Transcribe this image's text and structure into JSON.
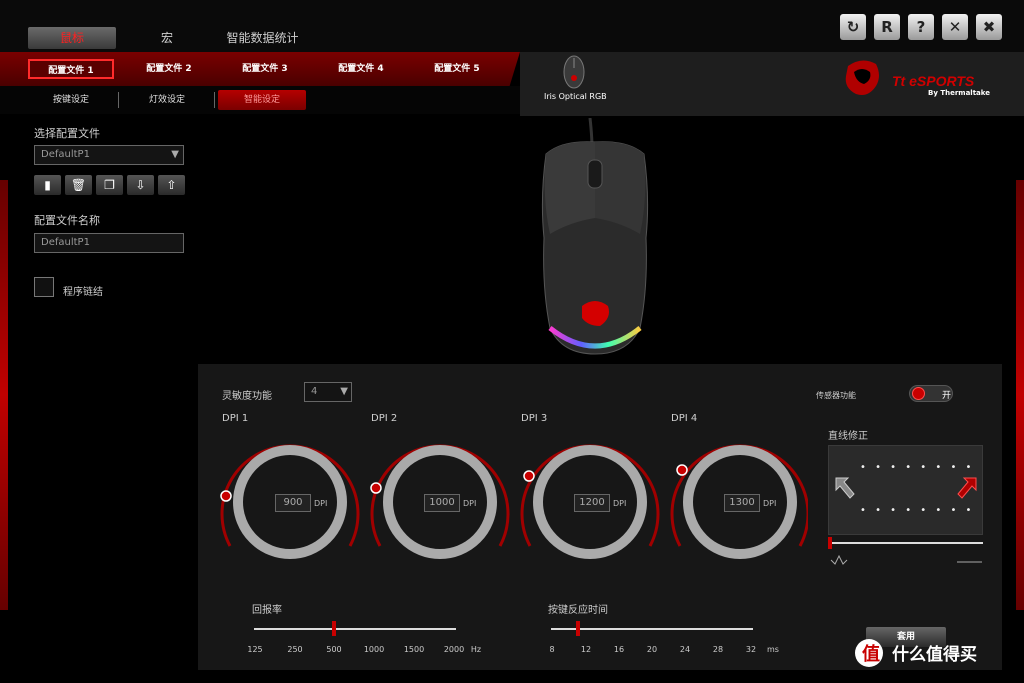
{
  "main_tabs": [
    "鼠标",
    "宏",
    "智能数据统计"
  ],
  "profile_tabs": [
    "配置文件 1",
    "配置文件 2",
    "配置文件 3",
    "配置文件 4",
    "配置文件 5"
  ],
  "sub_tabs": [
    "按键设定",
    "灯效设定",
    "智能设定"
  ],
  "device_name": "Iris Optical RGB",
  "brand": {
    "name": "Tt eSPORTS",
    "sub": "By Thermaltake"
  },
  "top_buttons": [
    {
      "icon": "refresh-icon",
      "glyph": "↻"
    },
    {
      "icon": "reset-icon",
      "glyph": "R"
    },
    {
      "icon": "help-icon",
      "glyph": "?"
    },
    {
      "icon": "close-icon",
      "glyph": "✕"
    },
    {
      "icon": "tools-icon",
      "glyph": "✖"
    }
  ],
  "left_panel": {
    "select_profile_label": "选择配置文件",
    "selected_profile": "DefaultP1",
    "profile_name_label": "配置文件名称",
    "profile_name_value": "DefaultP1",
    "link_program_label": "程序链结",
    "icon_buttons": [
      "save-icon",
      "delete-icon",
      "copy-icon",
      "import-icon",
      "export-icon"
    ]
  },
  "sensitivity": {
    "label": "灵敏度功能",
    "value": "4"
  },
  "sensor": {
    "label": "传感器功能",
    "toggle_text": "开"
  },
  "line_correction": {
    "label": "直线修正",
    "dots": "• • • • • • • •"
  },
  "dpi": [
    {
      "label": "DPI 1",
      "value": "900",
      "unit": "DPI"
    },
    {
      "label": "DPI 2",
      "value": "1000",
      "unit": "DPI"
    },
    {
      "label": "DPI 3",
      "value": "1200",
      "unit": "DPI"
    },
    {
      "label": "DPI 4",
      "value": "1300",
      "unit": "DPI"
    }
  ],
  "report_rate": {
    "label": "回报率",
    "ticks": [
      "125",
      "250",
      "500",
      "1000",
      "1500",
      "2000"
    ],
    "unit": "Hz",
    "selected": "500"
  },
  "response_time": {
    "label": "按键反应时间",
    "ticks": [
      "8",
      "12",
      "16",
      "20",
      "24",
      "28",
      "32"
    ],
    "unit": "ms",
    "selected": "10"
  },
  "apply_label": "套用",
  "watermark": "什么值得买",
  "colors": {
    "accent": "#c80000",
    "panel": "#171717",
    "header": "#1e1e1e"
  }
}
